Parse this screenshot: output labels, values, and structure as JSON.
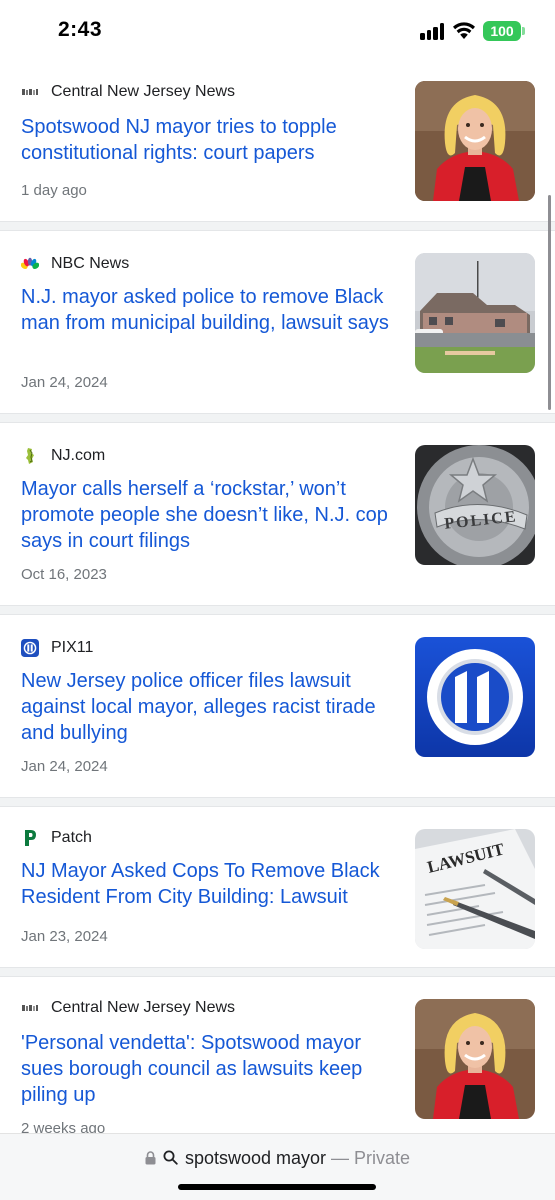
{
  "status": {
    "time": "2:43",
    "battery": "100"
  },
  "results": [
    {
      "source": "Central New Jersey News",
      "source_icon": "cnjn-logo-icon",
      "headline": "Spotswood NJ mayor tries to topple constitutional rights: court papers",
      "date": "1 day ago",
      "thumbnail": "mayor-portrait"
    },
    {
      "source": "NBC News",
      "source_icon": "nbc-peacock-icon",
      "headline": "N.J. mayor asked police to remove Black man from municipal building, lawsuit says",
      "date": "Jan 24, 2024",
      "thumbnail": "municipal-building-photo"
    },
    {
      "source": "NJ.com",
      "source_icon": "njcom-logo-icon",
      "headline": "Mayor calls herself a ‘rockstar,’ won’t promote people she doesn’t like, N.J. cop says in court filings",
      "date": "Oct 16, 2023",
      "thumbnail": "police-badge-photo",
      "thumb_text": "POLICE"
    },
    {
      "source": "PIX11",
      "source_icon": "pix11-logo-icon",
      "headline": "New Jersey police officer files lawsuit against local mayor, alleges racist tirade and bullying",
      "date": "Jan 24, 2024",
      "thumbnail": "pix11-logo"
    },
    {
      "source": "Patch",
      "source_icon": "patch-logo-icon",
      "headline": "NJ Mayor Asked Cops To Remove Black Resident From City Building: Lawsuit",
      "date": "Jan 23, 2024",
      "thumbnail": "lawsuit-document-photo",
      "thumb_text": "LAWSUIT"
    },
    {
      "source": "Central New Jersey News",
      "source_icon": "cnjn-logo-icon",
      "headline": "'Personal vendetta': Spotswood mayor sues borough council as lawsuits keep piling up",
      "date": "2 weeks ago",
      "thumbnail": "mayor-portrait"
    }
  ],
  "address_bar": {
    "query": "spotswood mayor",
    "separator": " — ",
    "mode": "Private"
  },
  "colors": {
    "link": "#1558d6",
    "meta": "#70757a",
    "battery": "#34c759"
  }
}
